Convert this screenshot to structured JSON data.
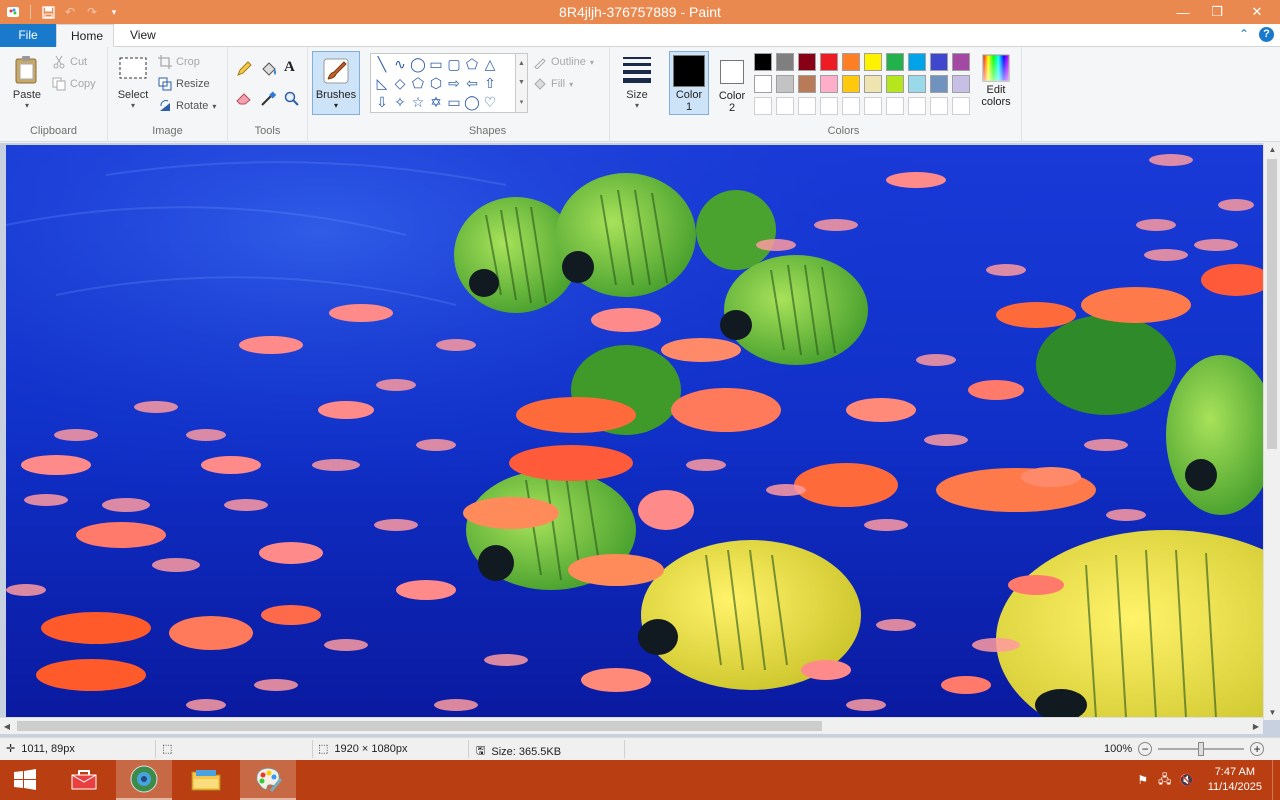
{
  "window": {
    "title": "8R4jljh-376757889 - Paint",
    "minimize_glyph": "—",
    "maximize_glyph": "❐",
    "close_glyph": "✕"
  },
  "qat": {
    "items": [
      "save-icon",
      "undo-icon",
      "redo-icon",
      "customize-icon"
    ]
  },
  "tabs": {
    "file": "File",
    "home": "Home",
    "view": "View",
    "help_glyph": "?"
  },
  "ribbon": {
    "clipboard": {
      "label": "Clipboard",
      "paste": "Paste",
      "cut": "Cut",
      "copy": "Copy"
    },
    "image": {
      "label": "Image",
      "select": "Select",
      "crop": "Crop",
      "resize": "Resize",
      "rotate": "Rotate"
    },
    "tools": {
      "label": "Tools",
      "items": [
        "pencil-icon",
        "fill-icon",
        "text-icon",
        "eraser-icon",
        "color-picker-icon",
        "magnifier-icon"
      ]
    },
    "brushes": {
      "label": "Brushes"
    },
    "shapes": {
      "label": "Shapes",
      "outline": "Outline",
      "fill": "Fill"
    },
    "size": {
      "label": "Size"
    },
    "colors": {
      "label": "Colors",
      "color1": "Color",
      "color1_num": "1",
      "color2": "Color",
      "color2_num": "2",
      "color1_value": "#000000",
      "color2_value": "#ffffff",
      "edit_line1": "Edit",
      "edit_line2": "colors",
      "palette_row1": [
        "#000000",
        "#7f7f7f",
        "#880015",
        "#ed1c24",
        "#ff7f27",
        "#fff200",
        "#22b14c",
        "#00a2e8",
        "#3f48cc",
        "#a349a4"
      ],
      "palette_row2": [
        "#ffffff",
        "#c3c3c3",
        "#b97a57",
        "#ffaec9",
        "#ffc90e",
        "#efe4b0",
        "#b5e61d",
        "#99d9ea",
        "#7092be",
        "#c8bfe7"
      ],
      "palette_row3": [
        "#ffffff",
        "#ffffff",
        "#ffffff",
        "#ffffff",
        "#ffffff",
        "#ffffff",
        "#ffffff",
        "#ffffff",
        "#ffffff",
        "#ffffff"
      ]
    }
  },
  "status": {
    "cursor_pos": "1011, 89px",
    "dimensions": "1920 × 1080px",
    "size": "Size: 365.5KB",
    "zoom": "100%"
  },
  "taskbar": {
    "time": "7:47 AM",
    "date": "11/14/2025"
  }
}
